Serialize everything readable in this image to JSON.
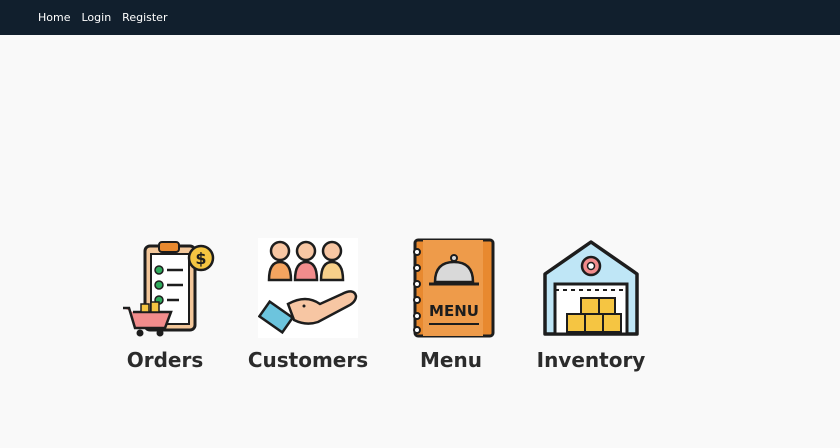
{
  "nav": {
    "home": "Home",
    "login": "Login",
    "register": "Register"
  },
  "tiles": [
    {
      "label": "Orders",
      "icon": "clipboard-checklist-cart-icon"
    },
    {
      "label": "Customers",
      "icon": "customers-hand-icon"
    },
    {
      "label": "Menu",
      "icon": "menu-book-cloche-icon"
    },
    {
      "label": "Inventory",
      "icon": "warehouse-boxes-icon"
    }
  ],
  "menu_icon_text": "MENU",
  "colors": {
    "navbar": "#111f2d",
    "background": "#f9f9f9",
    "label_text": "#2b2b2b",
    "menu_book": "#e8892f",
    "warehouse_sky": "#bfe6f6",
    "box_yellow": "#f5c542"
  }
}
